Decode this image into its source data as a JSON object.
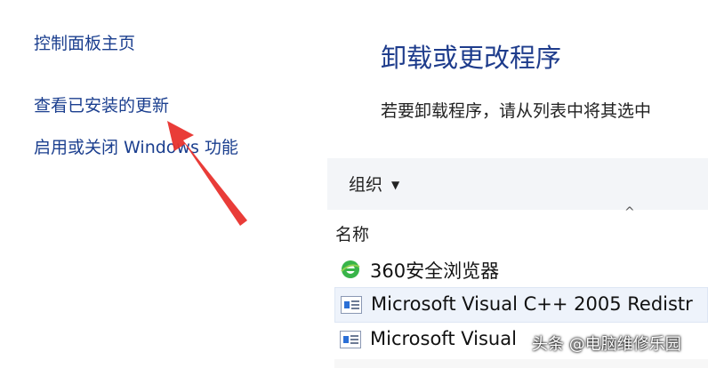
{
  "sidebar": {
    "items": [
      {
        "label": "控制面板主页"
      },
      {
        "label": "查看已安装的更新"
      },
      {
        "label": "启用或关闭 Windows 功能"
      }
    ]
  },
  "main": {
    "title": "卸载或更改程序",
    "description": "若要卸载程序，请从列表中将其选中",
    "toolbar": {
      "organize_label": "组织",
      "organize_caret": "▼"
    },
    "sort_caret": "^",
    "column_header": "名称",
    "programs": [
      {
        "name": "360安全浏览器",
        "icon": "360-browser-icon"
      },
      {
        "name": "Microsoft Visual C++ 2005 Redistr",
        "icon": "installer-package-icon"
      },
      {
        "name": "Microsoft Visual",
        "icon": "installer-package-icon"
      }
    ]
  },
  "watermark": {
    "text": "头条 @电脑维修乐园"
  },
  "colors": {
    "link": "#1b3f8f",
    "title": "#1e3c8c",
    "arrow": "#e8322d",
    "toolbar": "#f3f5f8"
  }
}
